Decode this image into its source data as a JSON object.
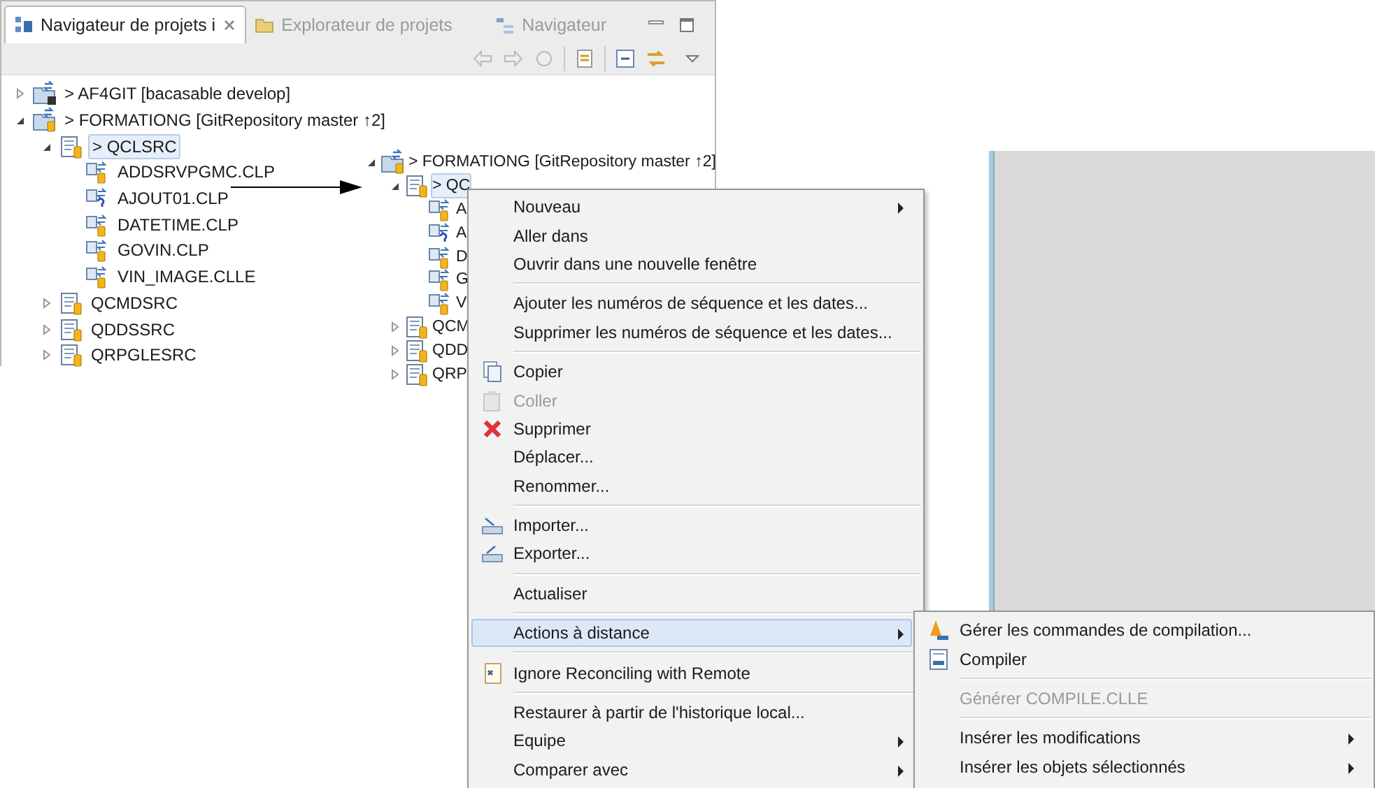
{
  "navigator": {
    "tabs": [
      {
        "label": "Navigateur de projets i",
        "selected": true,
        "kind": "projects"
      },
      {
        "label": "Explorateur de projets",
        "selected": false,
        "kind": "explorer"
      },
      {
        "label": "Navigateur",
        "selected": false,
        "kind": "navigator"
      }
    ],
    "tree": [
      {
        "label": "> AF4GIT [bacasable develop]",
        "kind": "project-remote",
        "expanded": false,
        "selected": false
      },
      {
        "label": "> FORMATIONG [GitRepository master ↑2]",
        "kind": "project",
        "expanded": true,
        "selected": false,
        "children": [
          {
            "label": "> QCLSRC",
            "kind": "library",
            "expanded": true,
            "selected": true,
            "children": [
              {
                "label": "ADDSRVPGMC.CLP",
                "kind": "member",
                "selected": false
              },
              {
                "label": "AJOUT01.CLP",
                "kind": "member-unknown",
                "selected": false
              },
              {
                "label": "DATETIME.CLP",
                "kind": "member",
                "selected": false
              },
              {
                "label": "GOVIN.CLP",
                "kind": "member",
                "selected": false
              },
              {
                "label": "VIN_IMAGE.CLLE",
                "kind": "member",
                "selected": false
              }
            ]
          },
          {
            "label": "QCMDSRC",
            "kind": "library",
            "expanded": false,
            "selected": false
          },
          {
            "label": "QDDSSRC",
            "kind": "library",
            "expanded": false,
            "selected": false
          },
          {
            "label": "QRPGLESRC",
            "kind": "library",
            "expanded": false,
            "selected": false
          }
        ]
      }
    ]
  },
  "second_view": {
    "tree": [
      {
        "label": "> FORMATIONG [GitRepository master ↑2]",
        "kind": "project",
        "expanded": true,
        "selected": false,
        "children": [
          {
            "label": "> QC",
            "kind": "library",
            "expanded": true,
            "selected": true,
            "children": [
              {
                "label": "A",
                "kind": "member",
                "selected": false
              },
              {
                "label": "A",
                "kind": "member-unknown",
                "selected": false
              },
              {
                "label": "D",
                "kind": "member",
                "selected": false
              },
              {
                "label": "G",
                "kind": "member",
                "selected": false
              },
              {
                "label": "V",
                "kind": "member",
                "selected": false
              }
            ]
          },
          {
            "label": "QCM",
            "kind": "library",
            "expanded": false,
            "selected": false
          },
          {
            "label": "QDD",
            "kind": "library",
            "expanded": false,
            "selected": false
          },
          {
            "label": "QRP",
            "kind": "library",
            "expanded": false,
            "selected": false
          }
        ]
      }
    ]
  },
  "context_menu": {
    "items": [
      {
        "kind": "item",
        "label": "Nouveau",
        "submenu": true,
        "disabled": false,
        "selected": false
      },
      {
        "kind": "item",
        "label": "Aller dans",
        "submenu": false,
        "disabled": false,
        "selected": false
      },
      {
        "kind": "item",
        "label": "Ouvrir dans une nouvelle fenêtre",
        "submenu": false,
        "disabled": false,
        "selected": false
      },
      {
        "kind": "separator"
      },
      {
        "kind": "item",
        "label": "Ajouter les numéros de séquence et les dates...",
        "submenu": false,
        "disabled": false,
        "selected": false
      },
      {
        "kind": "item",
        "label": "Supprimer les numéros de séquence et les dates...",
        "submenu": false,
        "disabled": false,
        "selected": false
      },
      {
        "kind": "separator"
      },
      {
        "kind": "copy",
        "label": "Copier",
        "submenu": false,
        "disabled": false,
        "selected": false
      },
      {
        "kind": "paste",
        "label": "Coller",
        "submenu": false,
        "disabled": true,
        "selected": false
      },
      {
        "kind": "delete",
        "label": "Supprimer",
        "submenu": false,
        "disabled": false,
        "selected": false
      },
      {
        "kind": "item",
        "label": "Déplacer...",
        "submenu": false,
        "disabled": false,
        "selected": false
      },
      {
        "kind": "item",
        "label": "Renommer...",
        "submenu": false,
        "disabled": false,
        "selected": false
      },
      {
        "kind": "separator"
      },
      {
        "kind": "import",
        "label": "Importer...",
        "submenu": false,
        "disabled": false,
        "selected": false
      },
      {
        "kind": "export",
        "label": "Exporter...",
        "submenu": false,
        "disabled": false,
        "selected": false
      },
      {
        "kind": "separator"
      },
      {
        "kind": "item",
        "label": "Actualiser",
        "submenu": false,
        "disabled": false,
        "selected": false
      },
      {
        "kind": "separator"
      },
      {
        "kind": "item",
        "label": "Actions à distance",
        "submenu": true,
        "disabled": false,
        "selected": true
      },
      {
        "kind": "separator"
      },
      {
        "kind": "ignore",
        "label": "Ignore Reconciling with Remote",
        "submenu": false,
        "disabled": false,
        "selected": false
      },
      {
        "kind": "separator"
      },
      {
        "kind": "item",
        "label": "Restaurer à partir de l'historique local...",
        "submenu": false,
        "disabled": false,
        "selected": false
      },
      {
        "kind": "item",
        "label": "Equipe",
        "submenu": true,
        "disabled": false,
        "selected": false
      },
      {
        "kind": "item",
        "label": "Comparer avec",
        "submenu": true,
        "disabled": false,
        "selected": false
      }
    ]
  },
  "submenu": {
    "items": [
      {
        "kind": "manage",
        "label": "Gérer les commandes de compilation...",
        "submenu": false,
        "disabled": false,
        "selected": false
      },
      {
        "kind": "compile",
        "label": "Compiler",
        "submenu": false,
        "disabled": false,
        "selected": false
      },
      {
        "kind": "separator"
      },
      {
        "kind": "item",
        "label": "Générer COMPILE.CLLE",
        "submenu": false,
        "disabled": true,
        "selected": false
      },
      {
        "kind": "separator"
      },
      {
        "kind": "item",
        "label": "Insérer les modifications",
        "submenu": true,
        "disabled": false,
        "selected": false
      },
      {
        "kind": "item",
        "label": "Insérer les objets sélectionnés",
        "submenu": true,
        "disabled": false,
        "selected": false
      }
    ]
  }
}
